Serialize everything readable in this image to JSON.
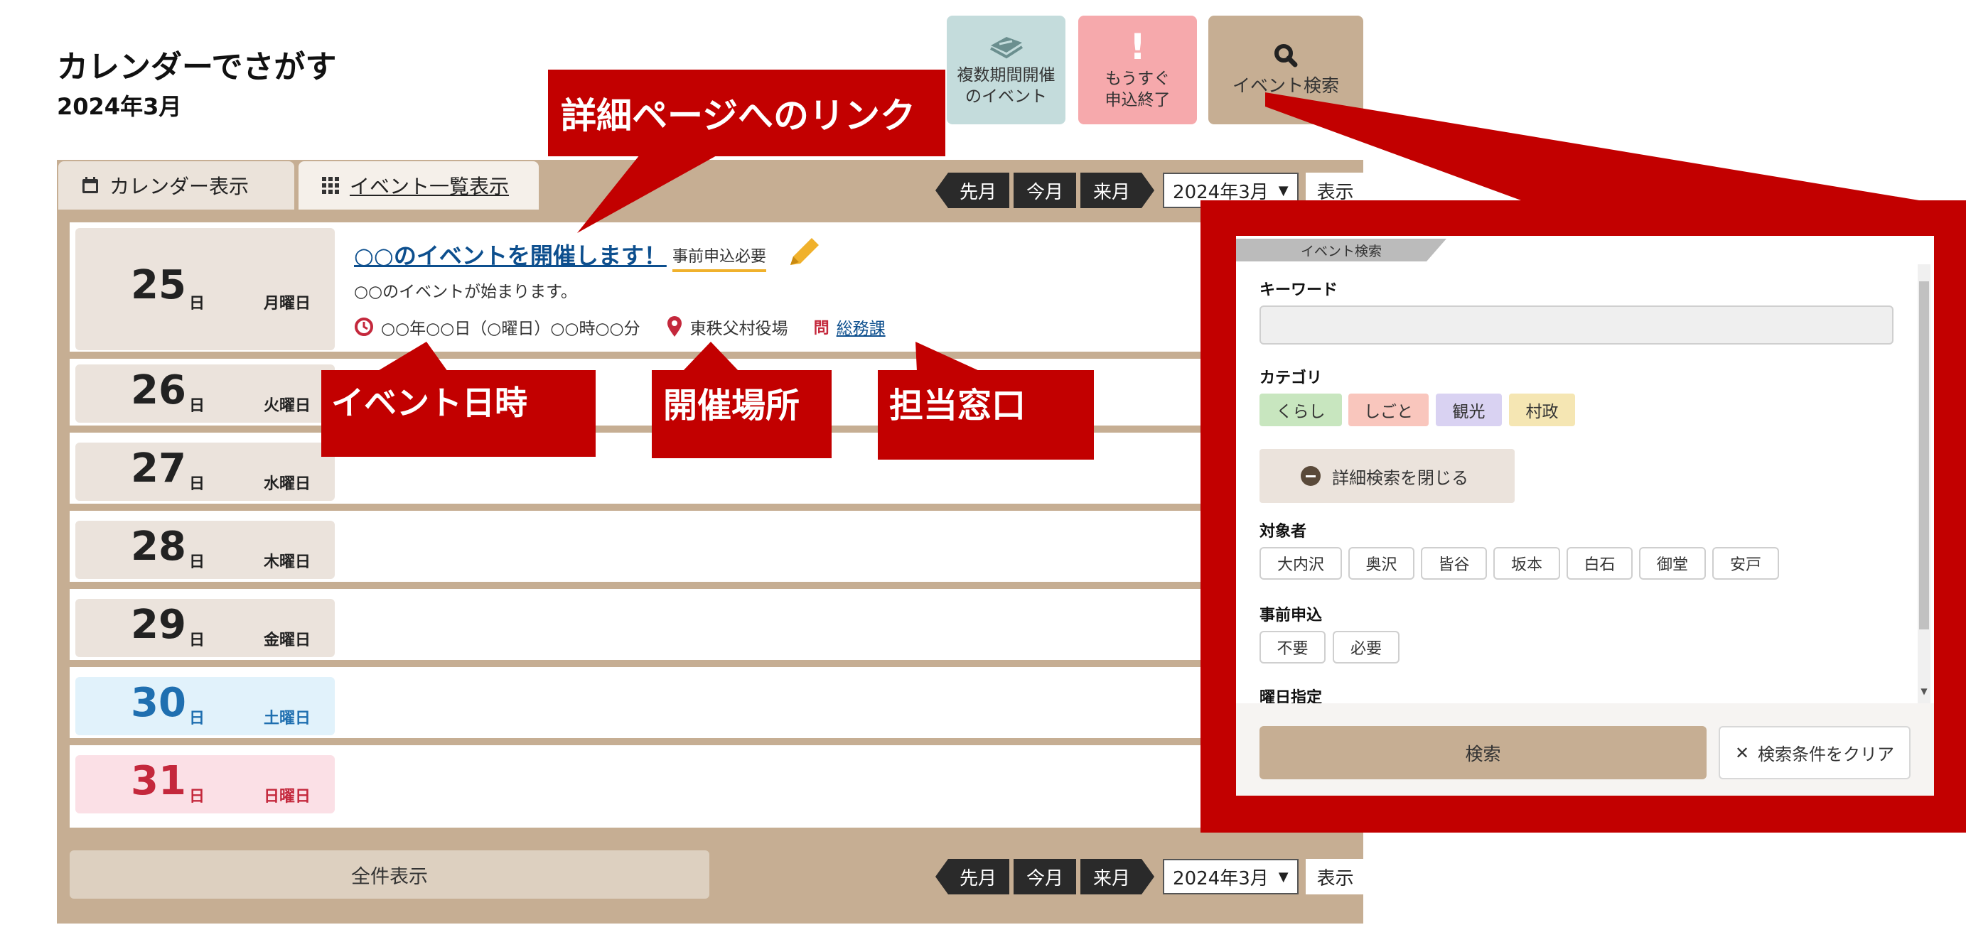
{
  "page": {
    "title": "カレンダーでさがす",
    "month": "2024年3月"
  },
  "top_buttons": {
    "multi_period": {
      "line1": "複数期間開催",
      "line2": "のイベント"
    },
    "closing_soon": {
      "mark": "!",
      "line1": "もうすぐ",
      "line2": "申込終了"
    },
    "event_search": {
      "label": "イベント検索"
    }
  },
  "tabs": {
    "calendar": "カレンダー表示",
    "list": "イベント一覧表示"
  },
  "nav": {
    "prev": "先月",
    "this": "今月",
    "next": "来月",
    "select_value": "2024年3月",
    "show": "表示"
  },
  "calendar": {
    "unit": "日",
    "days": [
      {
        "day": "25",
        "weekday": "月曜日",
        "type": "weekday"
      },
      {
        "day": "26",
        "weekday": "火曜日",
        "type": "weekday"
      },
      {
        "day": "27",
        "weekday": "水曜日",
        "type": "weekday"
      },
      {
        "day": "28",
        "weekday": "木曜日",
        "type": "weekday"
      },
      {
        "day": "29",
        "weekday": "金曜日",
        "type": "weekday"
      },
      {
        "day": "30",
        "weekday": "土曜日",
        "type": "saturday"
      },
      {
        "day": "31",
        "weekday": "日曜日",
        "type": "sunday"
      }
    ]
  },
  "event": {
    "title": "○○のイベントを開催します！",
    "badge": "事前申込必要",
    "description": "○○のイベントが始まります。",
    "datetime": "○○年○○日（○曜日）○○時○○分",
    "place": "東秩父村役場",
    "dept_icon": "問",
    "dept": "総務課"
  },
  "show_all": "全件表示",
  "callouts": {
    "link": "詳細ページへのリンク",
    "datetime": "イベント日時",
    "place": "開催場所",
    "dept": "担当窓口"
  },
  "search_panel": {
    "tab_label": "イベント検索",
    "keyword_label": "キーワード",
    "keyword_value": "",
    "category_label": "カテゴリ",
    "categories": [
      {
        "label": "くらし",
        "color": "#c8e6bf"
      },
      {
        "label": "しごと",
        "color": "#f9c6bd"
      },
      {
        "label": "観光",
        "color": "#d9d2f2"
      },
      {
        "label": "村政",
        "color": "#f5e6b3"
      }
    ],
    "close_advanced": "詳細検索を閉じる",
    "target_label": "対象者",
    "targets": [
      "大内沢",
      "奥沢",
      "皆谷",
      "坂本",
      "白石",
      "御堂",
      "安戸"
    ],
    "preapply_label": "事前申込",
    "preapply": [
      "不要",
      "必要"
    ],
    "weekday_label": "曜日指定",
    "search_button": "検索",
    "clear_button": "検索条件をクリア"
  },
  "colors": {
    "panel": "#c6ae93",
    "callout": "#c20000",
    "link": "#0d4f8e",
    "saturday": "#1f6fb0",
    "sunday": "#c4283c"
  }
}
